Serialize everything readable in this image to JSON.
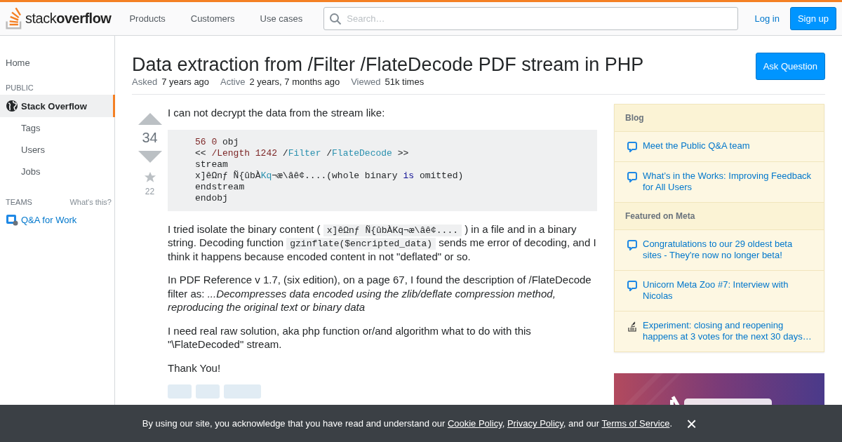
{
  "header": {
    "logo": {
      "light": "stack",
      "bold": "overflow"
    },
    "nav": [
      "Products",
      "Customers",
      "Use cases"
    ],
    "search": {
      "placeholder": "Search…"
    },
    "login": "Log in",
    "signup": "Sign up"
  },
  "sidebar": {
    "home": "Home",
    "public_label": "PUBLIC",
    "items": [
      {
        "label": "Stack Overflow",
        "selected": true,
        "kind": "site"
      },
      {
        "label": "Tags",
        "selected": false,
        "kind": "sub"
      },
      {
        "label": "Users",
        "selected": false,
        "kind": "sub"
      },
      {
        "label": "Jobs",
        "selected": false,
        "kind": "sub"
      }
    ],
    "teams_label": "TEAMS",
    "teams_help": "What's this?",
    "teams_link": "Q&A for Work"
  },
  "question": {
    "title": "Data extraction from /Filter /FlateDecode PDF stream in PHP",
    "ask_button": "Ask Question",
    "meta": [
      {
        "label": "Asked",
        "value": "7 years ago"
      },
      {
        "label": "Active",
        "value": "2 years, 7 months ago"
      },
      {
        "label": "Viewed",
        "value": "51k times"
      }
    ],
    "votes": "34",
    "favorites": "22",
    "intro": "I can not decrypt the data from the stream like:",
    "code": [
      [
        {
          "kind": "number",
          "text": "56 0"
        },
        {
          "kind": "plain",
          "text": " obj"
        }
      ],
      [
        {
          "kind": "plain",
          "text": "<< "
        },
        {
          "kind": "literal",
          "text": "/Length 1242"
        },
        {
          "kind": "plain",
          "text": " /"
        },
        {
          "kind": "type",
          "text": "Filter"
        },
        {
          "kind": "plain",
          "text": " /"
        },
        {
          "kind": "type",
          "text": "FlateDecode"
        },
        {
          "kind": "plain",
          "text": " >>"
        }
      ],
      [
        {
          "kind": "plain",
          "text": "stream"
        }
      ],
      [
        {
          "kind": "plain",
          "text": "x]êΩnƒ Ñ{ûbÀ"
        },
        {
          "kind": "type",
          "text": "Kq"
        },
        {
          "kind": "plain",
          "text": "¬æ\\âê¢....(whole binary "
        },
        {
          "kind": "keyword",
          "text": "is"
        },
        {
          "kind": "plain",
          "text": " omitted)"
        }
      ],
      [
        {
          "kind": "plain",
          "text": "endstream"
        }
      ],
      [
        {
          "kind": "plain",
          "text": "endobj"
        }
      ]
    ],
    "paragraphs": [
      [
        {
          "kind": "text",
          "text": "I tried isolate the binary content ( "
        },
        {
          "kind": "code",
          "text": "x]êΩnƒ Ñ{ûbÀKq¬æ\\âê¢...."
        },
        {
          "kind": "text",
          "text": " ) in a file and in a binary string. Decoding function "
        },
        {
          "kind": "code",
          "text": "gzinflate($encripted_data)"
        },
        {
          "kind": "text",
          "text": " sends me error of decoding, and I think it happens because encoded content in not \"deflated\" or so."
        }
      ],
      [
        {
          "kind": "text",
          "text": "In PDF Reference v 1.7, (six edition), on a page 67, I found the description of /FlateDecode filter as: "
        },
        {
          "kind": "italic",
          "text": "...Decompresses data encoded using the zlib/deflate compression method, reproducing the original text or binary data"
        }
      ],
      [
        {
          "kind": "text",
          "text": "I need real raw solution, aka php function or/and algorithm what to do with this \"\\FlateDecoded\" stream."
        }
      ],
      [
        {
          "kind": "text",
          "text": "Thank You!"
        }
      ]
    ],
    "tags": [
      {
        "kind": "tag"
      },
      {
        "kind": "tag"
      },
      {
        "kind": "tag"
      }
    ]
  },
  "widget": {
    "sections": [
      {
        "heading": "Blog",
        "items": [
          {
            "kind": "chat",
            "text": "Meet the Public Q&A team"
          },
          {
            "kind": "chat",
            "text": "What’s in the Works: Improving Feedback for All Users"
          }
        ]
      },
      {
        "heading": "Featured on Meta",
        "items": [
          {
            "kind": "chat",
            "text": "Congratulations to our 29 oldest beta sites - They're now no longer beta!"
          },
          {
            "kind": "chat",
            "text": "Unicorn Meta Zoo #7: Interview with Nicolas"
          },
          {
            "kind": "meta",
            "text": "Experiment: closing and reopening happens at 3 votes for the next 30 days…"
          }
        ]
      }
    ]
  },
  "cookie": {
    "text_before": "By using our site, you acknowledge that you have read and understand our ",
    "links": [
      {
        "text": "Cookie Policy",
        "after": ", "
      },
      {
        "text": "Privacy Policy",
        "after": ", and our "
      },
      {
        "text": "Terms of Service",
        "after": "."
      }
    ],
    "close": "×"
  }
}
